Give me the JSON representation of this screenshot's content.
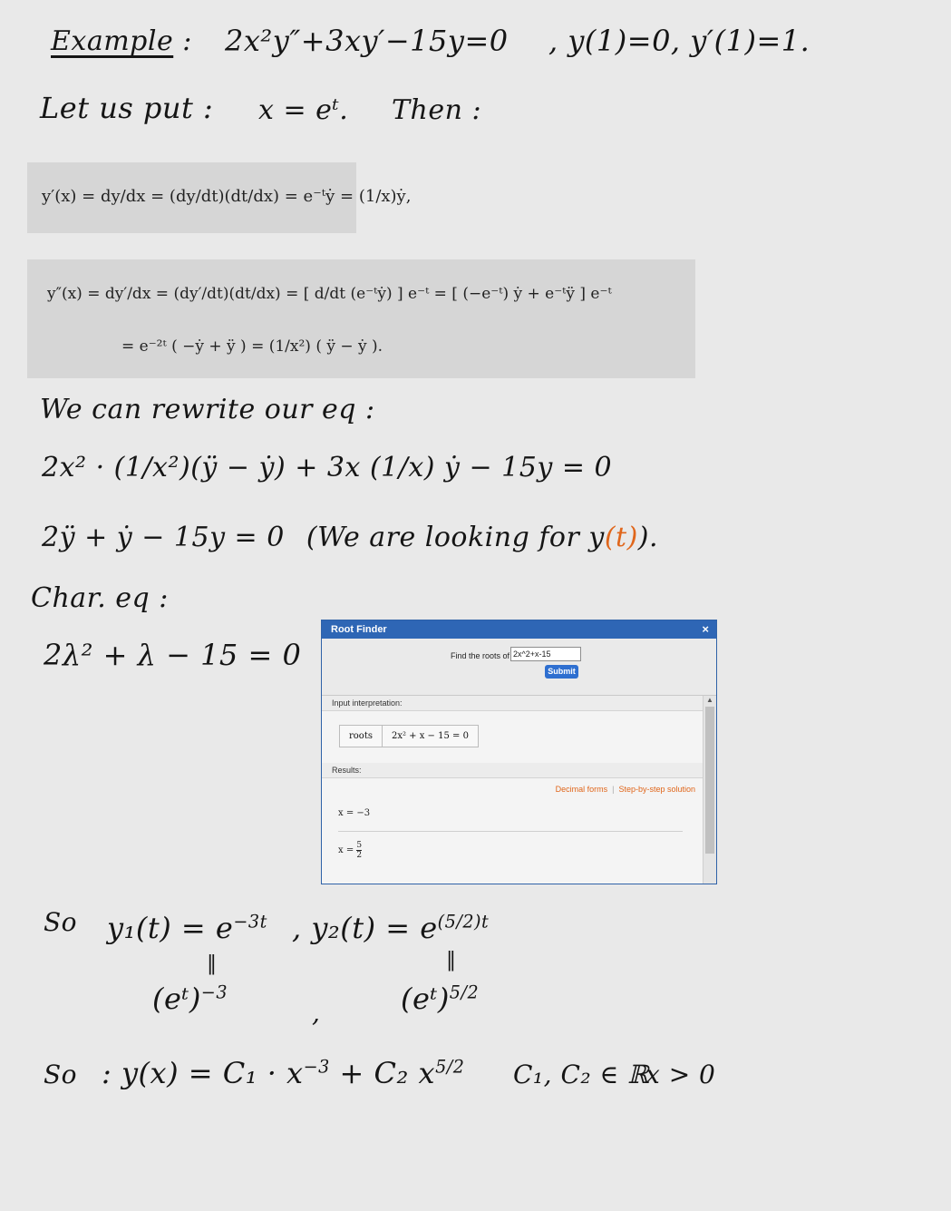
{
  "notes": {
    "example_label": "Example",
    "colon": ":",
    "equation": "2x²y″+3xy′−15y=0",
    "initial_conditions": ", y(1)=0, y′(1)=1.",
    "let_us_put": "Let us put :",
    "substitution": "x = eᵗ.",
    "then": "Then :",
    "rewrite": "We can rewrite our eq :",
    "rewritten_eq": "2x² · (1/x²)(ÿ − ẏ) + 3x (1/x) ẏ − 15y = 0",
    "reduced_eq": "2ÿ + ẏ − 15y = 0",
    "looking_for": "(We are looking for y",
    "looking_for_t": "(t)",
    "looking_for_end": ").",
    "char_eq_label": "Char. eq :",
    "char_eq": "2λ² + λ − 15 = 0",
    "so_1": "So",
    "y1": "y₁(t) = e",
    "y1_exp": "−3t",
    "y2": ", y₂(t) = e",
    "y2_exp": "(5/2)t",
    "equals_mark_1": "‖",
    "equals_mark_2": "‖",
    "et_pow_1": "(eᵗ)",
    "et_pow_1_exp": "−3",
    "comma_between": ",",
    "et_pow_2": "(eᵗ)",
    "et_pow_2_exp": "5/2",
    "so_2": "So",
    "general_solution": ": y(x) = C₁ · x",
    "gs_exp1": "−3",
    "gs_plus": "+ C₂ x",
    "gs_exp2": "5/2",
    "gs_constants": "C₁, C₂ ∈ ℝ",
    "gs_domain": "x > 0"
  },
  "formula1": {
    "text": "y′(x) = dy/dx = (dy/dt)(dt/dx) = e⁻ᵗẏ = (1/x)ẏ,"
  },
  "formula2": {
    "line1": "y″(x)  =  dy′/dx = (dy′/dt)(dt/dx) = [ d/dt (e⁻ᵗẏ) ] e⁻ᵗ = [ (−e⁻ᵗ) ẏ + e⁻ᵗÿ ] e⁻ᵗ",
    "line2": "=  e⁻²ᵗ ( −ẏ + ÿ ) = (1/x²) ( ÿ − ẏ ).",
    "line2_lead": "="
  },
  "root_finder": {
    "title": "Root Finder",
    "close": "×",
    "find_label": "Find the roots of",
    "input_value": "2x^2+x-15",
    "submit": "Submit",
    "input_interpretation_label": "Input interpretation:",
    "roots_label": "roots",
    "roots_expression": "2x² + x − 15 = 0",
    "results_label": "Results:",
    "decimal_forms": "Decimal forms",
    "step_by_step": "Step-by-step solution",
    "result1": "x = −3",
    "result2_prefix": "x =",
    "result2_num": "5",
    "result2_den": "2"
  }
}
